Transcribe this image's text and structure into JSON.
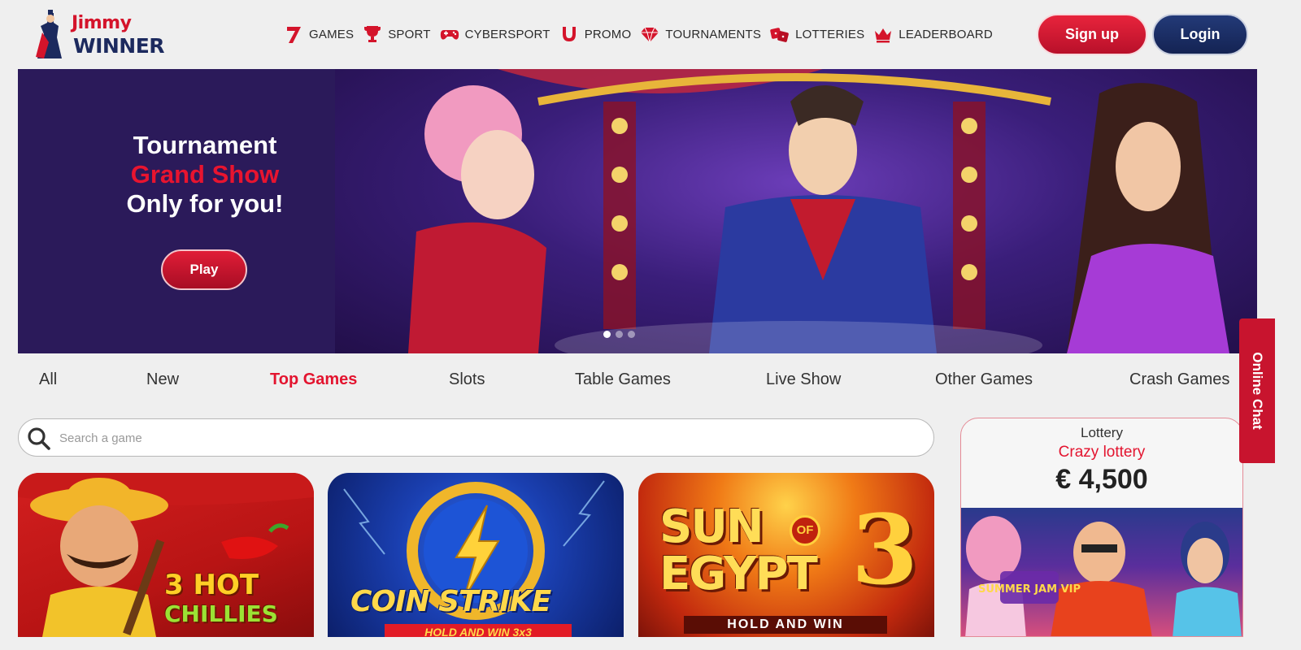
{
  "header": {
    "logo_line1": "Jimmy",
    "logo_line2": "WINNER",
    "nav": [
      {
        "label": "GAMES",
        "icon": "seven-icon"
      },
      {
        "label": "SPORT",
        "icon": "trophy-icon"
      },
      {
        "label": "CYBERSPORT",
        "icon": "gamepad-icon"
      },
      {
        "label": "PROMO",
        "icon": "horseshoe-icon"
      },
      {
        "label": "TOURNAMENTS",
        "icon": "diamond-icon"
      },
      {
        "label": "LOTTERIES",
        "icon": "dice-icon"
      },
      {
        "label": "LEADERBOARD",
        "icon": "crown-icon"
      }
    ],
    "signup_label": "Sign up",
    "login_label": "Login"
  },
  "banner": {
    "line1": "Tournament",
    "line2": "Grand Show",
    "line3": "Only for you!",
    "play_label": "Play",
    "slide_count": 3,
    "active_slide": 1
  },
  "categories": [
    {
      "label": "All",
      "active": false
    },
    {
      "label": "New",
      "active": false
    },
    {
      "label": "Top Games",
      "active": true
    },
    {
      "label": "Slots",
      "active": false
    },
    {
      "label": "Table Games",
      "active": false
    },
    {
      "label": "Live Show",
      "active": false
    },
    {
      "label": "Other Games",
      "active": false
    },
    {
      "label": "Crash Games",
      "active": false
    }
  ],
  "search": {
    "placeholder": "Search a game",
    "value": ""
  },
  "games": [
    {
      "title": "3 HOT",
      "subtitle": "CHILLIES"
    },
    {
      "title": "COIN STRIKE",
      "subtitle": "HOLD AND WIN 3x3"
    },
    {
      "title": "SUN OF EGYPT 3",
      "title_a": "SUN",
      "title_b": "EGYPT",
      "title_of": "OF",
      "title_num": "3",
      "subtitle": "HOLD AND WIN"
    }
  ],
  "lottery": {
    "kicker": "Lottery",
    "name": "Crazy lottery",
    "amount": "€ 4,500",
    "image_caption": "SUMMER JAM VIP"
  },
  "chat": {
    "label": "Online Chat"
  },
  "colors": {
    "accent_red": "#e3142f",
    "brand_navy": "#1c2a5e",
    "page_bg": "#efefef"
  }
}
